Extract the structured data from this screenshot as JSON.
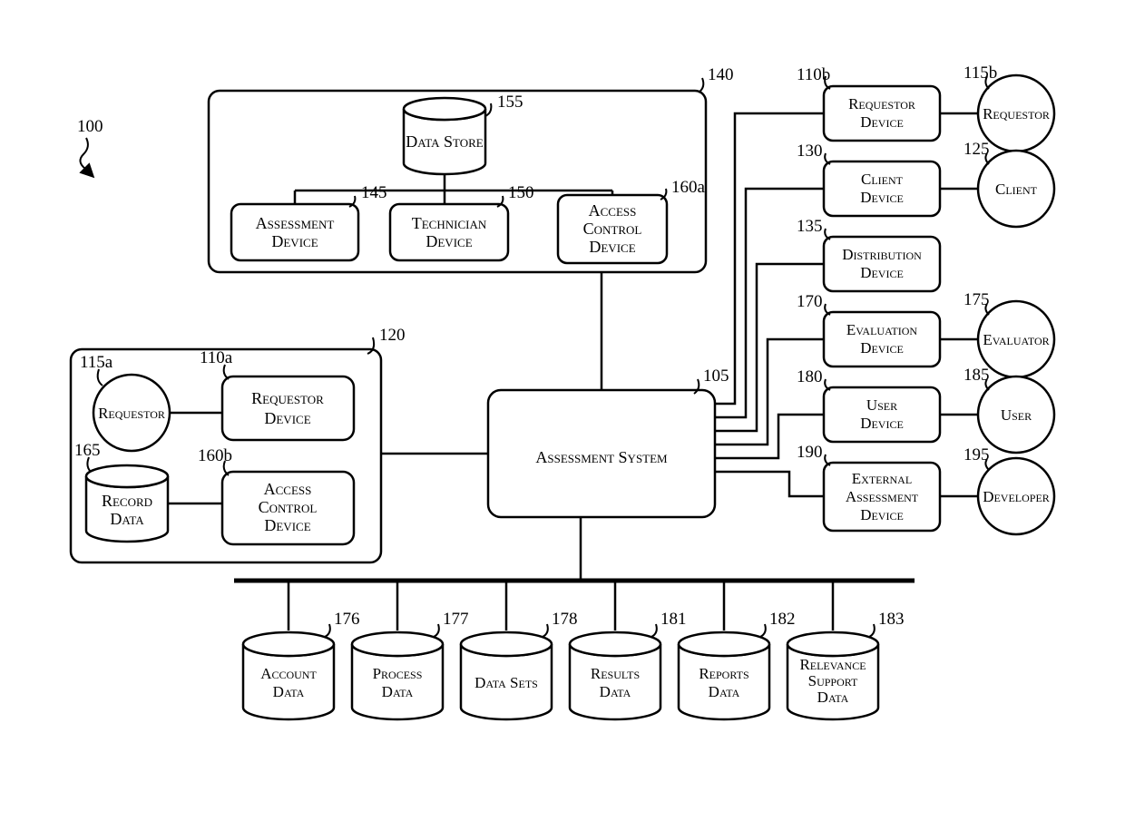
{
  "fig_ref": "100",
  "top_group_ref": "140",
  "data_store": {
    "label": "Data Store",
    "ref": "155"
  },
  "assessment_device": {
    "l1": "Assessment",
    "l2": "Device",
    "ref": "145"
  },
  "technician_device": {
    "l1": "Technician",
    "l2": "Device",
    "ref": "150"
  },
  "access_control_a": {
    "l1": "Access",
    "l2": "Control",
    "l3": "Device",
    "ref": "160a"
  },
  "left_group_ref": "120",
  "requestor_a": {
    "label": "Requestor",
    "ref": "115a"
  },
  "requestor_device_a": {
    "l1": "Requestor",
    "l2": "Device",
    "ref": "110a"
  },
  "record_data": {
    "l1": "Record",
    "l2": "Data",
    "ref": "165"
  },
  "access_control_b": {
    "l1": "Access",
    "l2": "Control",
    "l3": "Device",
    "ref": "160b"
  },
  "assessment_system": {
    "label": "Assessment System",
    "ref": "105"
  },
  "requestor_device_b": {
    "l1": "Requestor",
    "l2": "Device",
    "ref": "110b"
  },
  "requestor_b": {
    "label": "Requestor",
    "ref": "115b"
  },
  "client_device": {
    "l1": "Client",
    "l2": "Device",
    "ref": "130"
  },
  "client": {
    "label": "Client",
    "ref": "125"
  },
  "distribution_device": {
    "l1": "Distribution",
    "l2": "Device",
    "ref": "135"
  },
  "evaluation_device": {
    "l1": "Evaluation",
    "l2": "Device",
    "ref": "170"
  },
  "evaluator": {
    "label": "Evaluator",
    "ref": "175"
  },
  "user_device": {
    "l1": "User",
    "l2": "Device",
    "ref": "180"
  },
  "user": {
    "label": "User",
    "ref": "185"
  },
  "external_assessment": {
    "l1": "External",
    "l2": "Assessment",
    "l3": "Device",
    "ref": "190"
  },
  "developer": {
    "label": "Developer",
    "ref": "195"
  },
  "db_account": {
    "l1": "Account",
    "l2": "Data",
    "ref": "176"
  },
  "db_process": {
    "l1": "Process",
    "l2": "Data",
    "ref": "177"
  },
  "db_sets": {
    "l1": "Data Sets",
    "ref": "178"
  },
  "db_results": {
    "l1": "Results",
    "l2": "Data",
    "ref": "181"
  },
  "db_reports": {
    "l1": "Reports",
    "l2": "Data",
    "ref": "182"
  },
  "db_relevance": {
    "l1": "Relevance",
    "l2": "Support",
    "l3": "Data",
    "ref": "183"
  }
}
